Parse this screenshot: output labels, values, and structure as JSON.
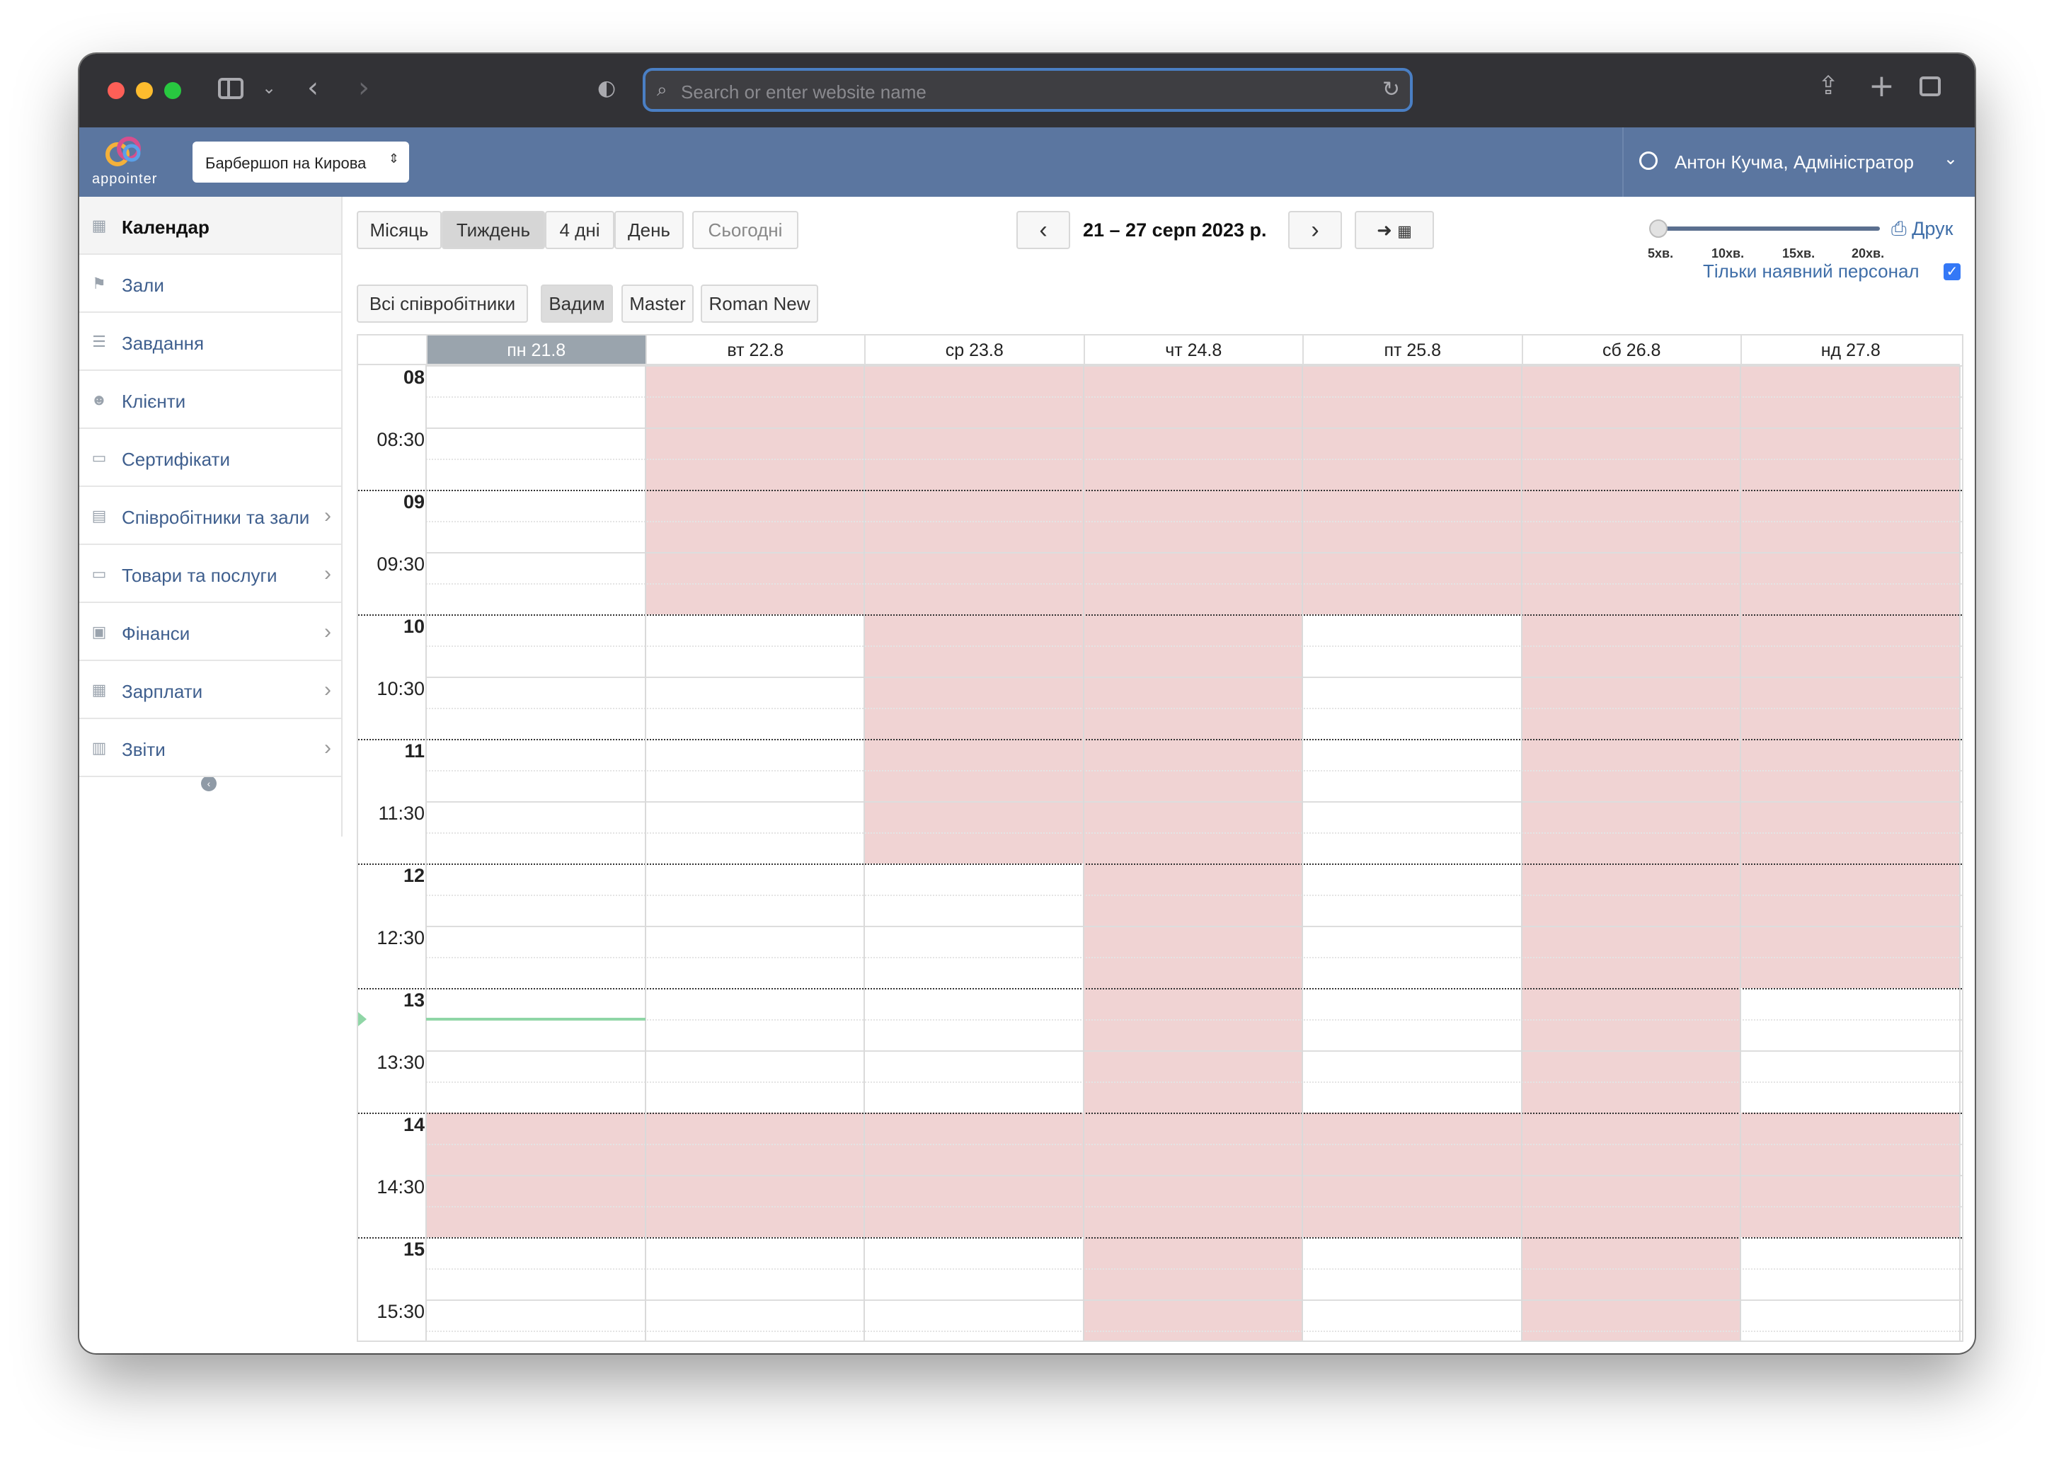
{
  "browser": {
    "url_placeholder": "Search or enter website name"
  },
  "app": {
    "logo_text": "appointer",
    "branch": "Барбершоп на Кирова",
    "user": "Антон Кучма, Адміністратор"
  },
  "nav": {
    "items": [
      {
        "label": "Календар",
        "icon": "calendar-icon",
        "active": true,
        "has_submenu": false
      },
      {
        "label": "Зали",
        "icon": "bookmark-icon",
        "active": false,
        "has_submenu": false
      },
      {
        "label": "Завдання",
        "icon": "tasks-icon",
        "active": false,
        "has_submenu": false
      },
      {
        "label": "Клієнти",
        "icon": "users-icon",
        "active": false,
        "has_submenu": false
      },
      {
        "label": "Сертифікати",
        "icon": "card-icon",
        "active": false,
        "has_submenu": false
      },
      {
        "label": "Співробітники та зали",
        "icon": "id-card-icon",
        "active": false,
        "has_submenu": true
      },
      {
        "label": "Товари та послуги",
        "icon": "card-icon",
        "active": false,
        "has_submenu": true
      },
      {
        "label": "Фінанси",
        "icon": "money-icon",
        "active": false,
        "has_submenu": true
      },
      {
        "label": "Зарплати",
        "icon": "calculator-icon",
        "active": false,
        "has_submenu": true
      },
      {
        "label": "Звіти",
        "icon": "bar-chart-icon",
        "active": false,
        "has_submenu": true
      }
    ]
  },
  "toolbar": {
    "views": [
      {
        "label": "Місяць",
        "active": false
      },
      {
        "label": "Тиждень",
        "active": true
      },
      {
        "label": "4 дні",
        "active": false
      },
      {
        "label": "День",
        "active": false
      }
    ],
    "today_label": "Сьогодні",
    "date_range": "21 – 27 серп 2023 р.",
    "print_label": "Друк",
    "slider_labels": [
      "5хв.",
      "10хв.",
      "15хв.",
      "20хв."
    ],
    "slider_value": "5хв.",
    "available_only_label": "Тільки наявний персонал",
    "available_only_checked": true
  },
  "staff_filter": [
    {
      "label": "Всі співробітники",
      "active": false
    },
    {
      "label": "Вадим",
      "active": true
    },
    {
      "label": "Master",
      "active": false
    },
    {
      "label": "Roman New",
      "active": false
    }
  ],
  "calendar": {
    "days": [
      "пн 21.8",
      "вт 22.8",
      "ср 23.8",
      "чт 24.8",
      "пт 25.8",
      "сб 26.8",
      "нд 27.8"
    ],
    "today_index": 0,
    "time_labels": [
      "08",
      "08:30",
      "09",
      "09:30",
      "10",
      "10:30",
      "11",
      "11:30",
      "12",
      "12:30",
      "13",
      "13:30",
      "14",
      "14:30",
      "15",
      "15:30"
    ],
    "unavailable": [
      {
        "days": [
          1,
          2,
          3,
          4,
          5,
          6
        ],
        "from": "08:00",
        "to": "10:00"
      },
      {
        "days": [
          2,
          3
        ],
        "from": "10:00",
        "to": "12:00"
      },
      {
        "days": [
          5,
          6
        ],
        "from": "10:00",
        "to": "13:00"
      },
      {
        "days": [
          3
        ],
        "from": "12:00",
        "to": "14:00"
      },
      {
        "days": [
          5
        ],
        "from": "13:00",
        "to": "14:00"
      },
      {
        "days": [
          0,
          1,
          2,
          3,
          4,
          5,
          6
        ],
        "from": "14:00",
        "to": "15:00"
      },
      {
        "days": [
          3,
          5
        ],
        "from": "15:00",
        "to": "16:00"
      }
    ],
    "now_time": "13:15",
    "colors": {
      "unavailable": "#f0d3d3",
      "today_header": "#9aa4ad",
      "now_line": "#8fd6a6"
    }
  }
}
